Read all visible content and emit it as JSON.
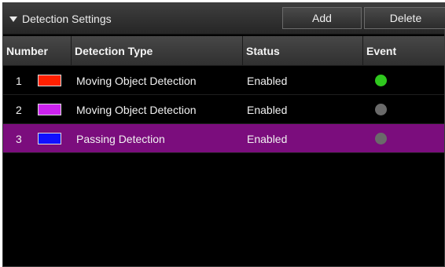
{
  "header": {
    "title": "Detection Settings",
    "add_label": "Add",
    "delete_label": "Delete"
  },
  "columns": {
    "number": "Number",
    "type": "Detection Type",
    "status": "Status",
    "event": "Event"
  },
  "rows": [
    {
      "number": "1",
      "color": "#ff2000",
      "type": "Moving Object Detection",
      "status": "Enabled",
      "event_color": "#2fc81e",
      "event_active": true,
      "selected": false
    },
    {
      "number": "2",
      "color": "#cc22ee",
      "type": "Moving Object Detection",
      "status": "Enabled",
      "event_color": "#6a6a6a",
      "event_active": false,
      "selected": false
    },
    {
      "number": "3",
      "color": "#1010ff",
      "type": "Passing Detection",
      "status": "Enabled",
      "event_color": "#6a6a6a",
      "event_active": false,
      "selected": true
    }
  ],
  "colors": {
    "selected_row": "#7b0d7d",
    "event_active": "#2fc81e",
    "event_inactive": "#6a6a6a"
  }
}
